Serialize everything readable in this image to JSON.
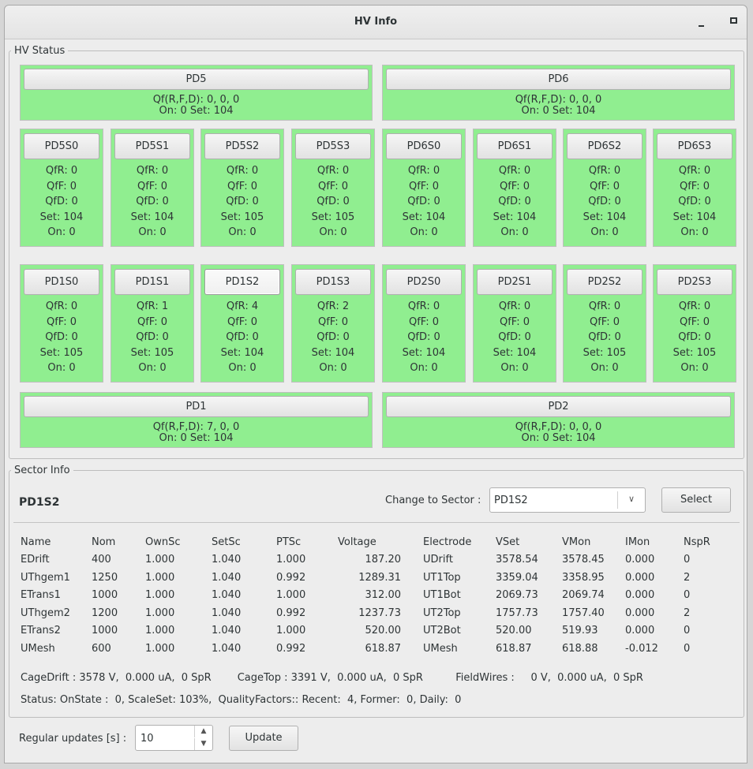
{
  "window": {
    "title": "HV Info"
  },
  "hv_status": {
    "legend": "HV Status",
    "big_panels_top": [
      {
        "button": "PD5",
        "qf": "Qf(R,F,D):  0,  0,  0",
        "onset": "On:  0   Set: 104"
      },
      {
        "button": "PD6",
        "qf": "Qf(R,F,D):  0,  0,  0",
        "onset": "On:  0   Set: 104"
      }
    ],
    "row1": [
      {
        "button": "PD5S0",
        "qfr": "QfR:  0",
        "qff": "QfF:  0",
        "qfd": "QfD:  0",
        "set": "Set: 104",
        "on": "On:  0"
      },
      {
        "button": "PD5S1",
        "qfr": "QfR:  0",
        "qff": "QfF:  0",
        "qfd": "QfD:  0",
        "set": "Set: 104",
        "on": "On:  0"
      },
      {
        "button": "PD5S2",
        "qfr": "QfR:  0",
        "qff": "QfF:  0",
        "qfd": "QfD:  0",
        "set": "Set: 105",
        "on": "On:  0"
      },
      {
        "button": "PD5S3",
        "qfr": "QfR:  0",
        "qff": "QfF:  0",
        "qfd": "QfD:  0",
        "set": "Set: 105",
        "on": "On:  0"
      },
      {
        "button": "PD6S0",
        "qfr": "QfR:  0",
        "qff": "QfF:  0",
        "qfd": "QfD:  0",
        "set": "Set: 104",
        "on": "On:  0"
      },
      {
        "button": "PD6S1",
        "qfr": "QfR:  0",
        "qff": "QfF:  0",
        "qfd": "QfD:  0",
        "set": "Set: 104",
        "on": "On:  0"
      },
      {
        "button": "PD6S2",
        "qfr": "QfR:  0",
        "qff": "QfF:  0",
        "qfd": "QfD:  0",
        "set": "Set: 104",
        "on": "On:  0"
      },
      {
        "button": "PD6S3",
        "qfr": "QfR:  0",
        "qff": "QfF:  0",
        "qfd": "QfD:  0",
        "set": "Set: 104",
        "on": "On:  0"
      }
    ],
    "row2": [
      {
        "button": "PD1S0",
        "qfr": "QfR:  0",
        "qff": "QfF:  0",
        "qfd": "QfD:  0",
        "set": "Set: 105",
        "on": "On:  0"
      },
      {
        "button": "PD1S1",
        "qfr": "QfR:  1",
        "qff": "QfF:  0",
        "qfd": "QfD:  0",
        "set": "Set: 105",
        "on": "On:  0"
      },
      {
        "button": "PD1S2",
        "qfr": "QfR:  4",
        "qff": "QfF:  0",
        "qfd": "QfD:  0",
        "set": "Set: 104",
        "on": "On:  0"
      },
      {
        "button": "PD1S3",
        "qfr": "QfR:  2",
        "qff": "QfF:  0",
        "qfd": "QfD:  0",
        "set": "Set: 104",
        "on": "On:  0"
      },
      {
        "button": "PD2S0",
        "qfr": "QfR:  0",
        "qff": "QfF:  0",
        "qfd": "QfD:  0",
        "set": "Set: 104",
        "on": "On:  0"
      },
      {
        "button": "PD2S1",
        "qfr": "QfR:  0",
        "qff": "QfF:  0",
        "qfd": "QfD:  0",
        "set": "Set: 104",
        "on": "On:  0"
      },
      {
        "button": "PD2S2",
        "qfr": "QfR:  0",
        "qff": "QfF:  0",
        "qfd": "QfD:  0",
        "set": "Set: 105",
        "on": "On:  0"
      },
      {
        "button": "PD2S3",
        "qfr": "QfR:  0",
        "qff": "QfF:  0",
        "qfd": "QfD:  0",
        "set": "Set: 105",
        "on": "On:  0"
      }
    ],
    "big_panels_bottom": [
      {
        "button": "PD1",
        "qf": "Qf(R,F,D):  7,  0,  0",
        "onset": "On:  0   Set: 104"
      },
      {
        "button": "PD2",
        "qf": "Qf(R,F,D):  0,  0,  0",
        "onset": "On:  0   Set: 104"
      }
    ],
    "ok_color": "#90ee90"
  },
  "sector_info": {
    "legend": "Sector Info",
    "title": "PD1S2",
    "change_label": "Change to Sector :",
    "selected_sector": "PD1S2",
    "select_button": "Select",
    "table": {
      "headers": [
        "Name",
        "Nom",
        "OwnSc",
        "SetSc",
        "PTSc",
        "Voltage",
        "Electrode",
        "VSet",
        "VMon",
        "IMon",
        "NspR"
      ],
      "rows": [
        [
          "EDrift",
          "400",
          "1.000",
          "1.040",
          "1.000",
          "187.20",
          "UDrift",
          "3578.54",
          "3578.45",
          "0.000",
          "0"
        ],
        [
          "UThgem1",
          "1250",
          "1.000",
          "1.040",
          "0.992",
          "1289.31",
          "UT1Top",
          "3359.04",
          "3358.95",
          "0.000",
          "2"
        ],
        [
          "ETrans1",
          "1000",
          "1.000",
          "1.040",
          "1.000",
          "312.00",
          "UT1Bot",
          "2069.73",
          "2069.74",
          "0.000",
          "0"
        ],
        [
          "UThgem2",
          "1200",
          "1.000",
          "1.040",
          "0.992",
          "1237.73",
          "UT2Top",
          "1757.73",
          "1757.40",
          "0.000",
          "2"
        ],
        [
          "ETrans2",
          "1000",
          "1.000",
          "1.040",
          "1.000",
          "520.00",
          "UT2Bot",
          "520.00",
          "519.93",
          "0.000",
          "0"
        ],
        [
          "UMesh",
          "600",
          "1.000",
          "1.040",
          "0.992",
          "618.87",
          "UMesh",
          "618.87",
          "618.88",
          "-0.012",
          "0"
        ]
      ]
    },
    "cage_line": "CageDrift : 3578 V,  0.000 uA,  0 SpR        CageTop : 3391 V,  0.000 uA,  0 SpR          FieldWires :     0 V,  0.000 uA,  0 SpR",
    "status_line": "Status: OnState :  0, ScaleSet: 103%,  QualityFactors:: Recent:  4, Former:  0, Daily:  0"
  },
  "footer": {
    "updates_label": "Regular updates [s] :",
    "updates_value": "10",
    "update_button": "Update"
  }
}
